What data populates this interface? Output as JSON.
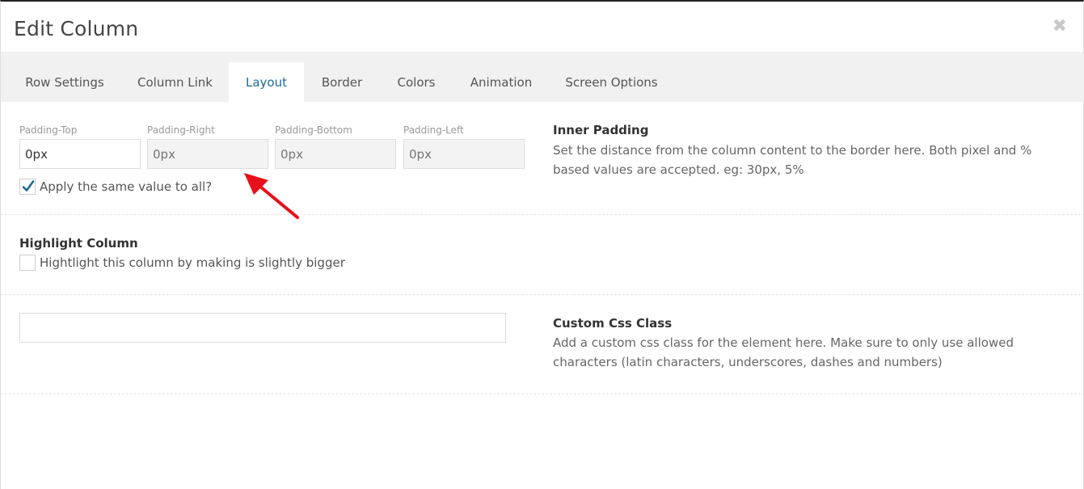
{
  "dialog": {
    "title": "Edit Column",
    "close_icon": "close-icon"
  },
  "tabs": [
    {
      "label": "Row Settings"
    },
    {
      "label": "Column Link"
    },
    {
      "label": "Layout",
      "active": true
    },
    {
      "label": "Border"
    },
    {
      "label": "Colors"
    },
    {
      "label": "Animation"
    },
    {
      "label": "Screen Options"
    }
  ],
  "padding": {
    "fields": [
      {
        "label": "Padding-Top",
        "value": "0px",
        "placeholder": "",
        "disabled": false
      },
      {
        "label": "Padding-Right",
        "value": "",
        "placeholder": "0px",
        "disabled": true
      },
      {
        "label": "Padding-Bottom",
        "value": "",
        "placeholder": "0px",
        "disabled": true
      },
      {
        "label": "Padding-Left",
        "value": "",
        "placeholder": "0px",
        "disabled": true
      }
    ],
    "apply_same": {
      "label": "Apply the same value to all?",
      "checked": true
    },
    "heading": "Inner Padding",
    "description": "Set the distance from the column content to the border here. Both pixel and % based values are accepted. eg: 30px, 5%"
  },
  "highlight": {
    "heading": "Highlight Column",
    "checkbox": {
      "label": "Hightlight this column by making is slightly bigger",
      "checked": false
    }
  },
  "custom_css": {
    "value": "",
    "heading": "Custom Css Class",
    "description": "Add a custom css class for the element here. Make sure to only use allowed characters (latin characters, underscores, dashes and numbers)"
  },
  "colors": {
    "active_tab_text": "#1e6a97",
    "tabbar_bg": "#f1f1f1",
    "checkbox_check": "#1e6a97",
    "annotation_arrow": "#e8101a"
  }
}
